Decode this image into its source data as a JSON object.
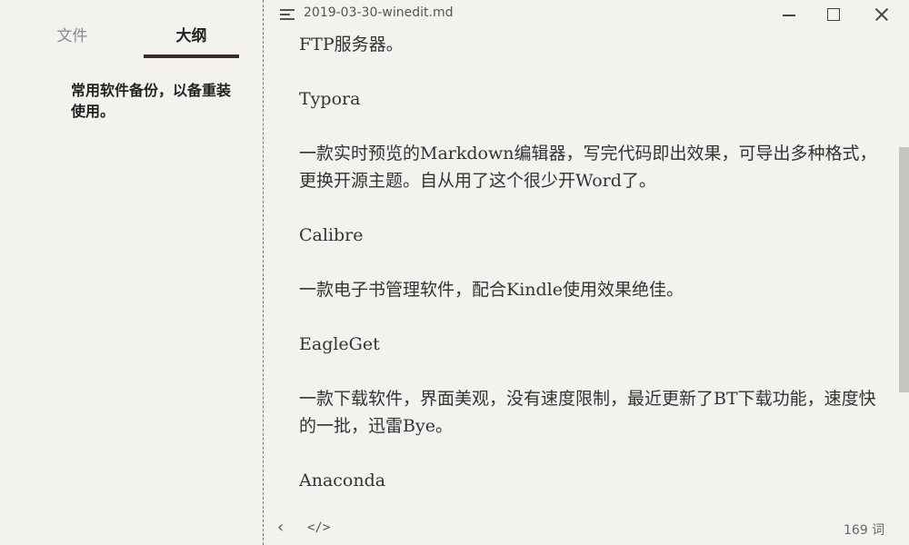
{
  "sidebar": {
    "tabs": [
      {
        "label": "文件",
        "active": false
      },
      {
        "label": "大纲",
        "active": true
      }
    ],
    "outline_items": [
      {
        "label": "常用软件备份，以备重装使用。"
      }
    ]
  },
  "window": {
    "title": "2019-03-30-winedit.md",
    "icons": [
      "menu-icon",
      "minimize-icon",
      "maximize-icon",
      "close-icon"
    ]
  },
  "editor": {
    "paragraphs": [
      "FTP服务器。",
      "Typora",
      "一款实时预览的Markdown编辑器，写完代码即出效果，可导出多种格式，更换开源主题。自从用了这个很少开Word了。",
      "Calibre",
      "一款电子书管理软件，配合Kindle使用效果绝佳。",
      "EagleGet",
      "一款下载软件，界面美观，没有速度限制，最近更新了BT下载功能，速度快的一批，迅雷Bye。",
      "Anaconda"
    ]
  },
  "statusbar": {
    "back_glyph": "‹",
    "code_glyph": "</>",
    "word_count": "169 词"
  },
  "colors": {
    "background": "#f3f2ee",
    "active_tab_underline": "#3a2a28",
    "scrollbar_thumb": "#c6c5c1"
  }
}
